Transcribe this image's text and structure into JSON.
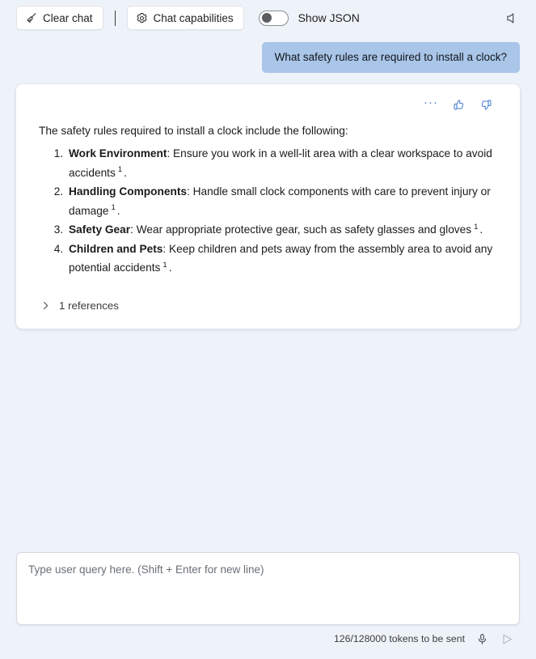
{
  "toolbar": {
    "clear_chat_label": "Clear chat",
    "clear_chat_icon": "broom-icon",
    "chat_capabilities_label": "Chat capabilities",
    "chat_capabilities_icon": "gear-icon",
    "show_json_label": "Show JSON",
    "show_json_state": "off",
    "speaker_icon": "speaker-mute-icon"
  },
  "conversation": {
    "user_message": "What safety rules are required to install a clock?",
    "assistant": {
      "actions": {
        "more_label": "···",
        "more_icon": "ellipsis-icon",
        "thumbs_up_icon": "thumbs-up-icon",
        "thumbs_down_icon": "thumbs-down-icon"
      },
      "intro": "The safety rules required to install a clock include the following:",
      "items": [
        {
          "title": "Work Environment",
          "text": ": Ensure you work in a well-lit area with a clear workspace to avoid accidents",
          "citation": "1",
          "trailing": "."
        },
        {
          "title": "Handling Components",
          "text": ": Handle small clock components with care to prevent injury or damage",
          "citation": "1",
          "trailing": "."
        },
        {
          "title": "Safety Gear",
          "text": ": Wear appropriate protective gear, such as safety glasses and gloves",
          "citation": "1",
          "trailing": "."
        },
        {
          "title": "Children and Pets",
          "text": ": Keep children and pets away from the assembly area to avoid any potential accidents",
          "citation": "1",
          "trailing": "."
        }
      ],
      "references_label": "1 references",
      "references_expanded": false,
      "references_icon": "chevron-right-icon"
    }
  },
  "composer": {
    "placeholder": "Type user query here. (Shift + Enter for new line)",
    "value": "",
    "token_count": "126/128000 tokens to be sent",
    "mic_icon": "microphone-icon",
    "send_icon": "send-icon"
  },
  "colors": {
    "page_background": "#eef2f9",
    "card_background": "#ffffff",
    "user_bubble": "#a9c5e8",
    "accent_blue": "#4a7fd0",
    "text_primary": "#1b1b1b",
    "text_muted": "#6a6f76",
    "border": "#d6dae0"
  }
}
